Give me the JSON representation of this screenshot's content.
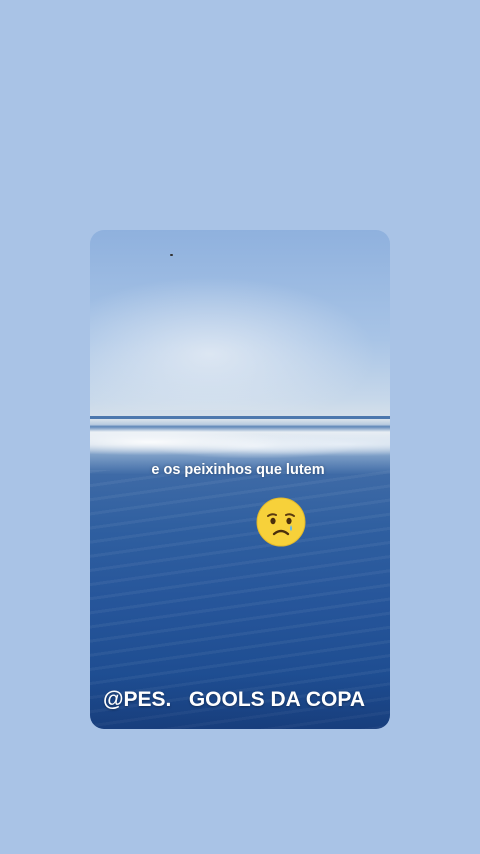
{
  "story": {
    "caption": "e os peixinhos que lutem",
    "watermark": "@PES.   GOOLS DA COPA",
    "emoji": "sad-tear-face-icon"
  },
  "colors": {
    "page_background": "#a9c3e6",
    "sea_deep": "#1e4d91",
    "text": "#ffffff",
    "emoji_yellow": "#f7d13a"
  }
}
